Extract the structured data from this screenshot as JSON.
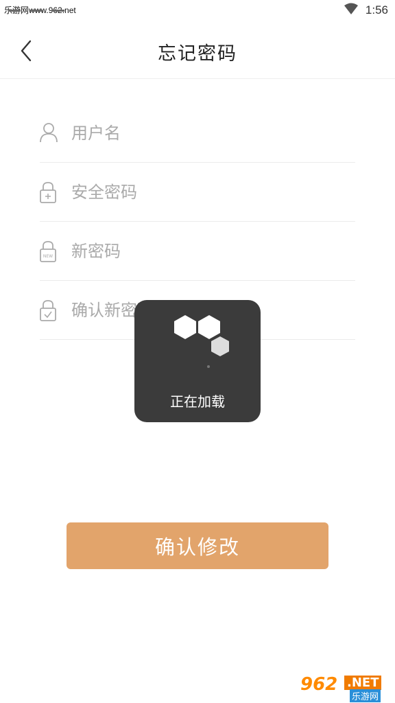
{
  "status_bar": {
    "site_text": "乐游网www.962.net",
    "time": "1:56"
  },
  "header": {
    "title": "忘记密码"
  },
  "form": {
    "username_placeholder": "用户名",
    "security_password_placeholder": "安全密码",
    "new_password_placeholder": "新密码",
    "confirm_password_placeholder": "确认新密码"
  },
  "confirm_button": {
    "label": "确认修改"
  },
  "loading": {
    "text": "正在加载"
  },
  "watermark": {
    "number": "962",
    "net": ".NET",
    "cn": "乐游网"
  },
  "icons": {
    "back": "chevron-left-icon",
    "wifi": "wifi-icon",
    "user": "user-icon",
    "lock_plus": "lock-plus-icon",
    "lock_new": "lock-new-icon",
    "lock_check": "lock-check-icon"
  },
  "colors": {
    "accent": "#e2a46b",
    "loading_bg": "#3b3b3b"
  }
}
